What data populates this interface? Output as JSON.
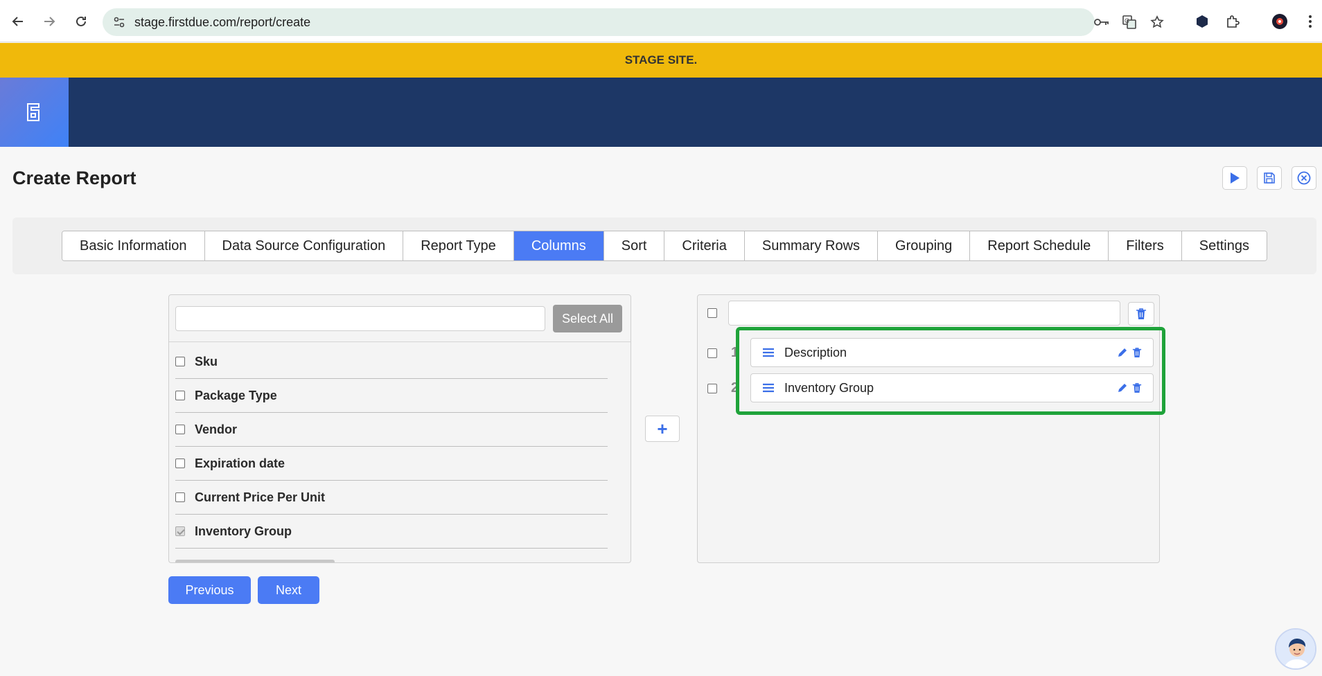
{
  "browser": {
    "url": "stage.firstdue.com/report/create"
  },
  "banner": {
    "text": "STAGE SITE."
  },
  "page": {
    "title": "Create Report"
  },
  "tabs": [
    {
      "label": "Basic Information",
      "active": false
    },
    {
      "label": "Data Source Configuration",
      "active": false
    },
    {
      "label": "Report Type",
      "active": false
    },
    {
      "label": "Columns",
      "active": true
    },
    {
      "label": "Sort",
      "active": false
    },
    {
      "label": "Criteria",
      "active": false
    },
    {
      "label": "Summary Rows",
      "active": false
    },
    {
      "label": "Grouping",
      "active": false
    },
    {
      "label": "Report Schedule",
      "active": false
    },
    {
      "label": "Filters",
      "active": false
    },
    {
      "label": "Settings",
      "active": false
    }
  ],
  "available_fields": {
    "search_value": "",
    "select_all_label": "Select All",
    "items": [
      {
        "label": "Sku",
        "checked": false
      },
      {
        "label": "Package Type",
        "checked": false
      },
      {
        "label": "Vendor",
        "checked": false
      },
      {
        "label": "Expiration date",
        "checked": false
      },
      {
        "label": "Current Price Per Unit",
        "checked": false
      },
      {
        "label": "Inventory Group",
        "checked": true
      }
    ]
  },
  "selected_columns": {
    "items": [
      {
        "number": "1",
        "label": "Description"
      },
      {
        "number": "2",
        "label": "Inventory Group"
      }
    ]
  },
  "buttons": {
    "add": "+",
    "previous": "Previous",
    "next": "Next"
  },
  "colors": {
    "accent": "#4b7bf4",
    "header": "#1d3766",
    "banner": "#f0b90b",
    "highlight": "#1fa33a"
  }
}
